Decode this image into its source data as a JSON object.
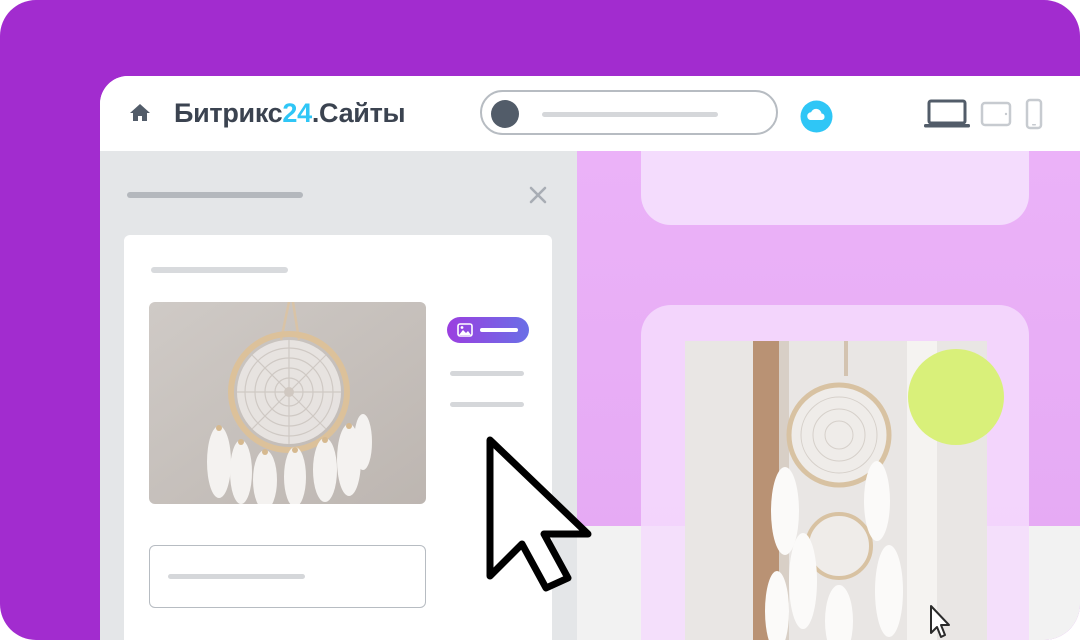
{
  "header": {
    "brand_part1": "Битрикс",
    "brand_part2": "24",
    "brand_part3": ".Сайты",
    "icons": [
      "home-icon",
      "cloud-icon",
      "desktop-icon",
      "tablet-icon",
      "mobile-icon"
    ]
  },
  "panel": {
    "close_icon": "close-icon",
    "chip_icon": "image-icon"
  },
  "colors": {
    "background": "#a22ccf",
    "brand_dark": "#3b4350",
    "brand_accent": "#2fc6f6",
    "cloud": "#2fc6f6",
    "panel_bg": "#e4e6e8",
    "preview_pink": "#e8b0f7",
    "preview_card": "#f3d9fd",
    "lime_circle": "#d9f07a",
    "chip_gradient_start": "#9b3fe0",
    "chip_gradient_end": "#6a6fe6"
  }
}
